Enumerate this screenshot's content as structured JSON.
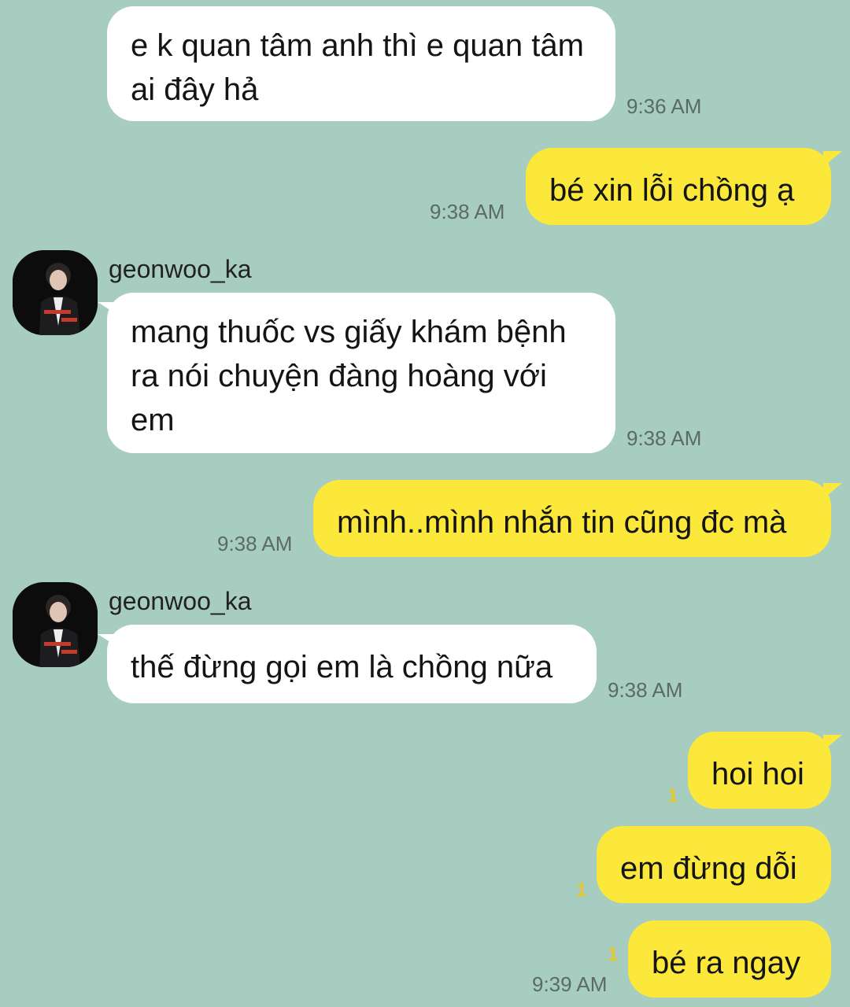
{
  "contact": {
    "name": "geonwoo_ka"
  },
  "colors": {
    "background": "#a6cdc0",
    "incoming_bubble": "#ffffff",
    "outgoing_bubble": "#fbe83b",
    "unread": "#e8c92a"
  },
  "messages": [
    {
      "sender": "geonwoo_ka",
      "text": "e k quan tâm anh thì e quan tâm ai đây hả",
      "time": "9:36 AM"
    },
    {
      "sender": "me",
      "text": "bé xin lỗi chồng ạ",
      "time": "9:38 AM"
    },
    {
      "sender": "geonwoo_ka",
      "text": "mang thuốc vs giấy khám bệnh ra nói chuyện đàng hoàng với em",
      "time": "9:38 AM"
    },
    {
      "sender": "me",
      "text": "mình..mình nhắn tin cũng đc mà",
      "time": "9:38 AM"
    },
    {
      "sender": "geonwoo_ka",
      "text": "thế đừng gọi em là chồng nữa",
      "time": "9:38 AM"
    },
    {
      "sender": "me",
      "text": "hoi hoi",
      "unread": "1"
    },
    {
      "sender": "me",
      "text": "em đừng dỗi",
      "unread": "1"
    },
    {
      "sender": "me",
      "text": "bé ra ngay",
      "unread": "1",
      "time": "9:39 AM"
    }
  ]
}
